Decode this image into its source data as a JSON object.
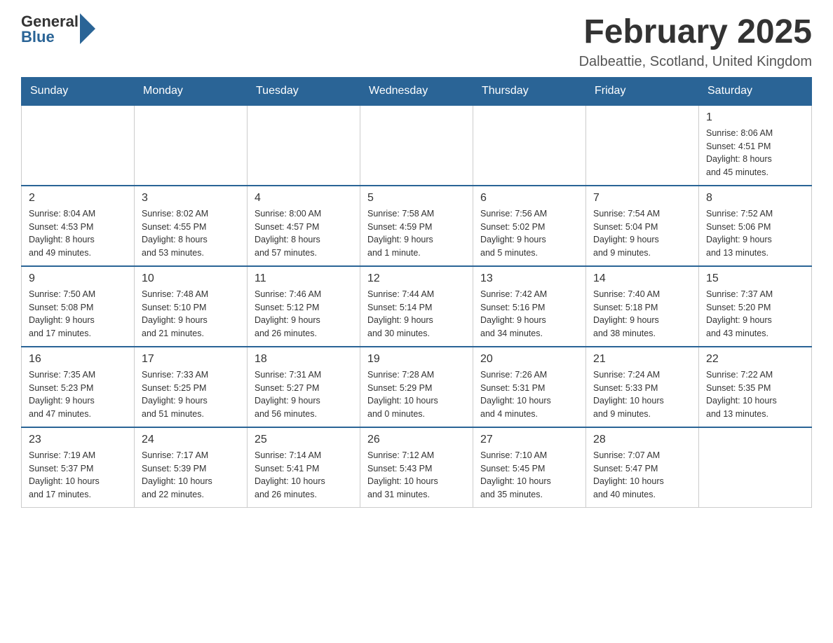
{
  "header": {
    "logo_general": "General",
    "logo_blue": "Blue",
    "title": "February 2025",
    "subtitle": "Dalbeattie, Scotland, United Kingdom"
  },
  "weekdays": [
    "Sunday",
    "Monday",
    "Tuesday",
    "Wednesday",
    "Thursday",
    "Friday",
    "Saturday"
  ],
  "weeks": [
    [
      {
        "day": "",
        "info": ""
      },
      {
        "day": "",
        "info": ""
      },
      {
        "day": "",
        "info": ""
      },
      {
        "day": "",
        "info": ""
      },
      {
        "day": "",
        "info": ""
      },
      {
        "day": "",
        "info": ""
      },
      {
        "day": "1",
        "info": "Sunrise: 8:06 AM\nSunset: 4:51 PM\nDaylight: 8 hours\nand 45 minutes."
      }
    ],
    [
      {
        "day": "2",
        "info": "Sunrise: 8:04 AM\nSunset: 4:53 PM\nDaylight: 8 hours\nand 49 minutes."
      },
      {
        "day": "3",
        "info": "Sunrise: 8:02 AM\nSunset: 4:55 PM\nDaylight: 8 hours\nand 53 minutes."
      },
      {
        "day": "4",
        "info": "Sunrise: 8:00 AM\nSunset: 4:57 PM\nDaylight: 8 hours\nand 57 minutes."
      },
      {
        "day": "5",
        "info": "Sunrise: 7:58 AM\nSunset: 4:59 PM\nDaylight: 9 hours\nand 1 minute."
      },
      {
        "day": "6",
        "info": "Sunrise: 7:56 AM\nSunset: 5:02 PM\nDaylight: 9 hours\nand 5 minutes."
      },
      {
        "day": "7",
        "info": "Sunrise: 7:54 AM\nSunset: 5:04 PM\nDaylight: 9 hours\nand 9 minutes."
      },
      {
        "day": "8",
        "info": "Sunrise: 7:52 AM\nSunset: 5:06 PM\nDaylight: 9 hours\nand 13 minutes."
      }
    ],
    [
      {
        "day": "9",
        "info": "Sunrise: 7:50 AM\nSunset: 5:08 PM\nDaylight: 9 hours\nand 17 minutes."
      },
      {
        "day": "10",
        "info": "Sunrise: 7:48 AM\nSunset: 5:10 PM\nDaylight: 9 hours\nand 21 minutes."
      },
      {
        "day": "11",
        "info": "Sunrise: 7:46 AM\nSunset: 5:12 PM\nDaylight: 9 hours\nand 26 minutes."
      },
      {
        "day": "12",
        "info": "Sunrise: 7:44 AM\nSunset: 5:14 PM\nDaylight: 9 hours\nand 30 minutes."
      },
      {
        "day": "13",
        "info": "Sunrise: 7:42 AM\nSunset: 5:16 PM\nDaylight: 9 hours\nand 34 minutes."
      },
      {
        "day": "14",
        "info": "Sunrise: 7:40 AM\nSunset: 5:18 PM\nDaylight: 9 hours\nand 38 minutes."
      },
      {
        "day": "15",
        "info": "Sunrise: 7:37 AM\nSunset: 5:20 PM\nDaylight: 9 hours\nand 43 minutes."
      }
    ],
    [
      {
        "day": "16",
        "info": "Sunrise: 7:35 AM\nSunset: 5:23 PM\nDaylight: 9 hours\nand 47 minutes."
      },
      {
        "day": "17",
        "info": "Sunrise: 7:33 AM\nSunset: 5:25 PM\nDaylight: 9 hours\nand 51 minutes."
      },
      {
        "day": "18",
        "info": "Sunrise: 7:31 AM\nSunset: 5:27 PM\nDaylight: 9 hours\nand 56 minutes."
      },
      {
        "day": "19",
        "info": "Sunrise: 7:28 AM\nSunset: 5:29 PM\nDaylight: 10 hours\nand 0 minutes."
      },
      {
        "day": "20",
        "info": "Sunrise: 7:26 AM\nSunset: 5:31 PM\nDaylight: 10 hours\nand 4 minutes."
      },
      {
        "day": "21",
        "info": "Sunrise: 7:24 AM\nSunset: 5:33 PM\nDaylight: 10 hours\nand 9 minutes."
      },
      {
        "day": "22",
        "info": "Sunrise: 7:22 AM\nSunset: 5:35 PM\nDaylight: 10 hours\nand 13 minutes."
      }
    ],
    [
      {
        "day": "23",
        "info": "Sunrise: 7:19 AM\nSunset: 5:37 PM\nDaylight: 10 hours\nand 17 minutes."
      },
      {
        "day": "24",
        "info": "Sunrise: 7:17 AM\nSunset: 5:39 PM\nDaylight: 10 hours\nand 22 minutes."
      },
      {
        "day": "25",
        "info": "Sunrise: 7:14 AM\nSunset: 5:41 PM\nDaylight: 10 hours\nand 26 minutes."
      },
      {
        "day": "26",
        "info": "Sunrise: 7:12 AM\nSunset: 5:43 PM\nDaylight: 10 hours\nand 31 minutes."
      },
      {
        "day": "27",
        "info": "Sunrise: 7:10 AM\nSunset: 5:45 PM\nDaylight: 10 hours\nand 35 minutes."
      },
      {
        "day": "28",
        "info": "Sunrise: 7:07 AM\nSunset: 5:47 PM\nDaylight: 10 hours\nand 40 minutes."
      },
      {
        "day": "",
        "info": ""
      }
    ]
  ]
}
